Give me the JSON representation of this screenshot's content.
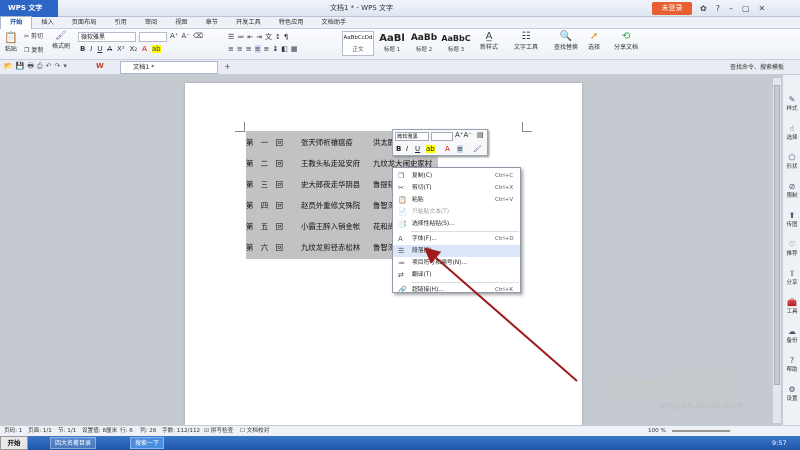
{
  "app": {
    "menu_label": "WPS 文字",
    "title": "文档1 * - WPS 文字",
    "login": "未登录"
  },
  "tabs": [
    "开始",
    "插入",
    "页面布局",
    "引用",
    "审阅",
    "视图",
    "章节",
    "开发工具",
    "特色应用",
    "文档助手"
  ],
  "ribbon": {
    "paste": "粘贴",
    "cut": "剪切",
    "copy": "复制",
    "format_painter": "格式刷",
    "font_name": "微软雅黑",
    "styles": [
      {
        "sample": "AaBbCcDd",
        "label": "正文"
      },
      {
        "sample": "AaBl",
        "label": "标题 1"
      },
      {
        "sample": "AaBb",
        "label": "标题 2"
      },
      {
        "sample": "AaBbC",
        "label": "标题 3"
      }
    ],
    "new_style": "新样式",
    "text_tools": "文字工具",
    "find_replace": "查找替换",
    "select": "选择",
    "share_doc": "分享文档"
  },
  "doc_tab": "文档1 *",
  "search_cmd": "查找命令、搜索模板",
  "table": [
    {
      "num": "第　一　回",
      "title": "张天师祈禳瘟疫",
      "right": "洪太尉"
    },
    {
      "num": "第　二　回",
      "title": "王教头私走延安府",
      "right": "九纹龙大闹史家村"
    },
    {
      "num": "第　三　回",
      "title": "史大郎夜走华阴县",
      "right": "鲁提辖"
    },
    {
      "num": "第　四　回",
      "title": "赵员外重修文殊院",
      "right": "鲁智深"
    },
    {
      "num": "第　五　回",
      "title": "小霸王醉入销金帐",
      "right": "花和尚"
    },
    {
      "num": "第　六　回",
      "title": "九纹龙剪径赤松林",
      "right": "鲁智深"
    }
  ],
  "mini_toolbar": {
    "font": "微软雅黑"
  },
  "context_menu": [
    {
      "label": "复制(C)",
      "shortcut": "Ctrl+C",
      "icon": "copy-icon",
      "state": "normal"
    },
    {
      "label": "剪切(T)",
      "shortcut": "Ctrl+X",
      "icon": "scissors-icon",
      "state": "normal"
    },
    {
      "label": "粘贴",
      "shortcut": "Ctrl+V",
      "icon": "paste-icon",
      "state": "normal"
    },
    {
      "label": "只粘贴文本(T)",
      "shortcut": "",
      "icon": "paste-text-icon",
      "state": "disabled"
    },
    {
      "label": "选择性粘贴(S)...",
      "shortcut": "",
      "icon": "paste-special-icon",
      "state": "normal"
    },
    {
      "label": "字体(F)...",
      "shortcut": "Ctrl+D",
      "icon": "font-icon",
      "state": "normal"
    },
    {
      "label": "段落(P)...",
      "shortcut": "",
      "icon": "paragraph-icon",
      "state": "highlighted"
    },
    {
      "label": "项目符号和编号(N)...",
      "shortcut": "",
      "icon": "list-icon",
      "state": "normal"
    },
    {
      "label": "翻译(T)",
      "shortcut": "",
      "icon": "translate-icon",
      "state": "normal"
    },
    {
      "label": "超链接(H)...",
      "shortcut": "Ctrl+K",
      "icon": "link-icon",
      "state": "normal"
    }
  ],
  "right_panel": [
    "样式",
    "选择",
    "形状",
    "限制",
    "传图",
    "推荐",
    "分享",
    "工具",
    "备份",
    "帮助",
    "设置"
  ],
  "status": {
    "page": "页码: 1",
    "pages": "页面: 1/1",
    "section": "节: 1/1",
    "setting": "设置值: 8厘米",
    "row": "行: 6",
    "col": "列: 26",
    "words": "字数: 112/112",
    "spell": "拼写检查",
    "doc_check": "文档校对",
    "zoom": "100 %"
  },
  "taskbar": {
    "start": "开始",
    "items": [
      "四大名著目录",
      "搜索一下"
    ],
    "clock": "9:57"
  },
  "watermark": {
    "logo": "Bai经验",
    "url": "jingyan.baidu.com"
  },
  "colors": {
    "accent": "#2d66c4",
    "login": "#e8602f",
    "arrow": "#a01b1b"
  }
}
